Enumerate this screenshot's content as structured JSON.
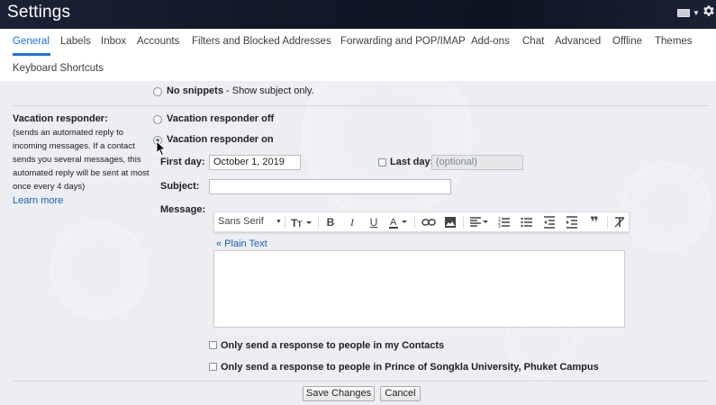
{
  "header": {
    "title": "Settings"
  },
  "tabs": [
    {
      "label": "General",
      "active": true
    },
    {
      "label": "Labels"
    },
    {
      "label": "Inbox"
    },
    {
      "label": "Accounts"
    },
    {
      "label": "Filters and Blocked Addresses"
    },
    {
      "label": "Forwarding and POP/IMAP"
    },
    {
      "label": "Add-ons"
    },
    {
      "label": "Chat"
    },
    {
      "label": "Advanced"
    },
    {
      "label": "Offline"
    },
    {
      "label": "Themes"
    },
    {
      "label": "Keyboard Shortcuts"
    }
  ],
  "snippets": {
    "option_bold": "No snippets",
    "option_rest": " - Show subject only."
  },
  "vacation": {
    "heading": "Vacation responder:",
    "description": "(sends an automated reply to incoming messages. If a contact sends you several messages, this automated reply will be sent at most once every 4 days)",
    "learn_more": "Learn more",
    "off_label": "Vacation responder off",
    "on_label": "Vacation responder on",
    "selected": "on",
    "first_day_label": "First day:",
    "first_day_value": "October 1, 2019",
    "last_day_label": "Last day:",
    "last_day_placeholder": "(optional)",
    "subject_label": "Subject:",
    "subject_value": "",
    "message_label": "Message:",
    "plain_text_link": "« Plain Text",
    "contacts_only_label": "Only send a response to people in my Contacts",
    "domain_only_label": "Only send a response to people in Prince of Songkla University, Phuket Campus"
  },
  "toolbar": {
    "font_name": "Sans Serif",
    "icons": [
      "font-size-icon",
      "bold-icon",
      "italic-icon",
      "underline-icon",
      "text-color-icon",
      "link-icon",
      "image-icon",
      "align-icon",
      "numbered-list-icon",
      "bulleted-list-icon",
      "indent-less-icon",
      "indent-more-icon",
      "quote-icon",
      "remove-formatting-icon"
    ]
  },
  "actions": {
    "save_label": "Save Changes",
    "cancel_label": "Cancel"
  },
  "colors": {
    "accent": "#1a73e8",
    "link": "#1a5ebd"
  }
}
